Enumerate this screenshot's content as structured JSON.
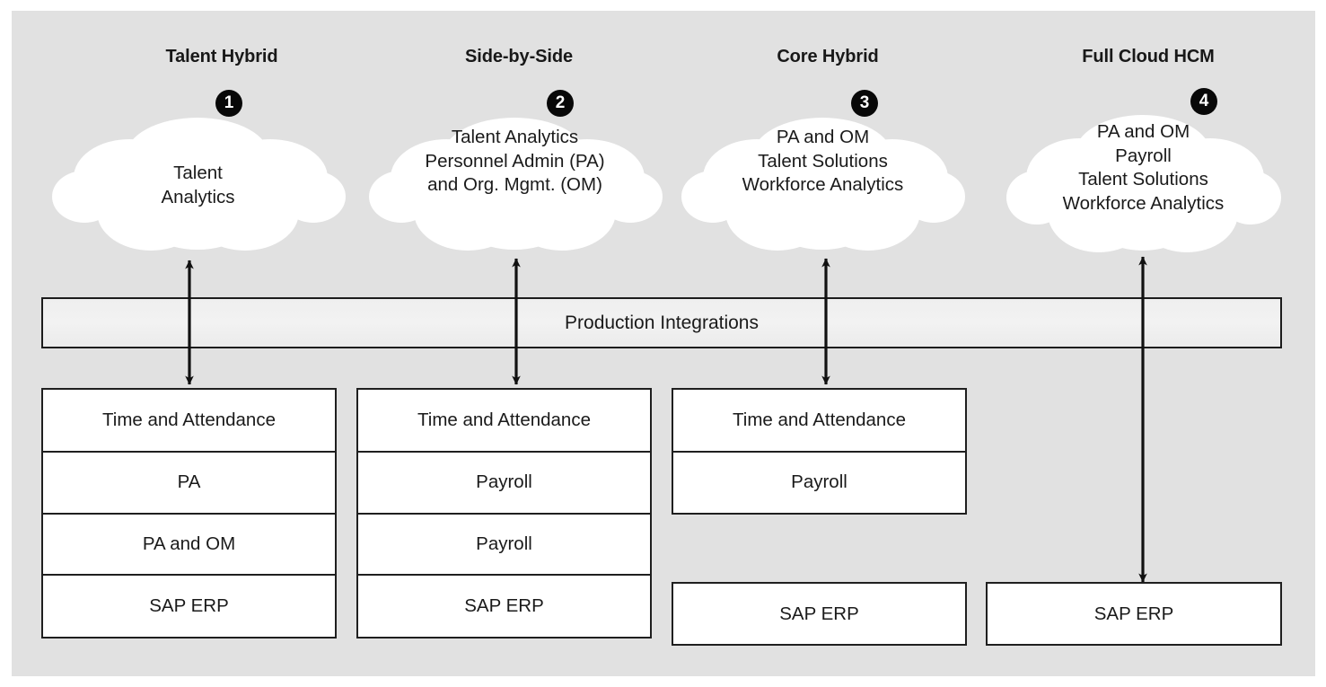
{
  "diagram": {
    "title_absent": true,
    "background_color": "#e1e1e1",
    "accent_color": "#080808",
    "integration_bar": {
      "label": "Production Integrations"
    },
    "columns": [
      {
        "heading": "Talent Hybrid",
        "badge": "1",
        "cloud_lines": [
          "Talent",
          "Analytics"
        ],
        "boxes": [
          "Time and Attendance",
          "PA",
          "PA and OM",
          "SAP ERP"
        ]
      },
      {
        "heading": "Side-by-Side",
        "badge": "2",
        "cloud_lines": [
          "Talent Analytics",
          "Personnel Admin (PA)",
          "and Org. Mgmt. (OM)"
        ],
        "boxes": [
          "Time and Attendance",
          "Payroll",
          "Payroll",
          "SAP ERP"
        ]
      },
      {
        "heading": "Core Hybrid",
        "badge": "3",
        "cloud_lines": [
          "PA and OM",
          "Talent Solutions",
          "Workforce Analytics"
        ],
        "boxes": [
          "Time and Attendance",
          "Payroll",
          "SAP ERP"
        ]
      },
      {
        "heading": "Full Cloud HCM",
        "badge": "4",
        "cloud_lines": [
          "PA and OM",
          "Payroll",
          "Talent Solutions",
          "Workforce Analytics"
        ],
        "boxes": [
          "SAP ERP"
        ]
      }
    ]
  }
}
